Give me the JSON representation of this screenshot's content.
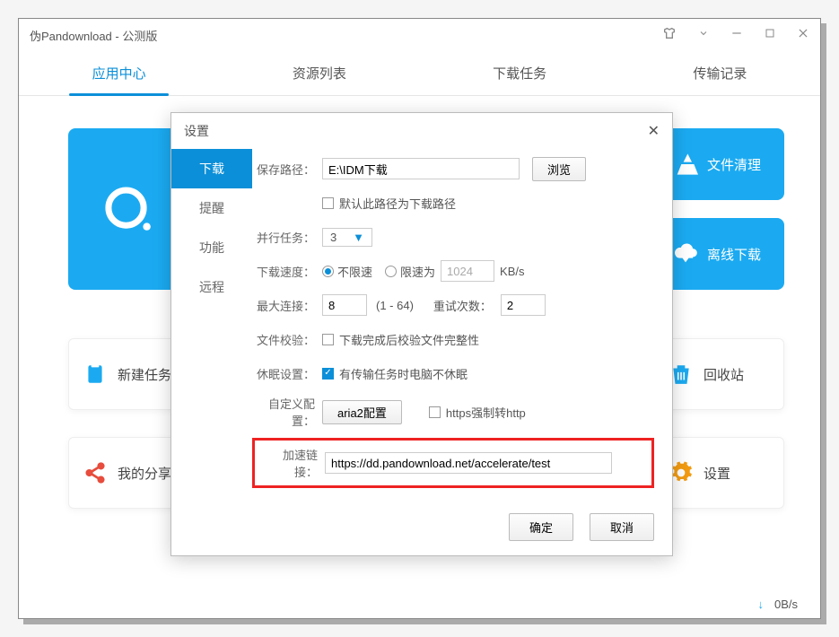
{
  "window": {
    "title": "伪Pandownload - 公测版"
  },
  "tabs": [
    "应用中心",
    "资源列表",
    "下载任务",
    "传输记录"
  ],
  "active_tab": 0,
  "right_tiles": [
    {
      "label": "文件清理"
    },
    {
      "label": "离线下载"
    }
  ],
  "bottom_items": {
    "new_task": "新建任务",
    "my_share": "我的分享",
    "recycle": "回收站",
    "settings": "设置"
  },
  "statusbar": {
    "speed": "0B/s"
  },
  "dialog": {
    "title": "设置",
    "sidebar": [
      "下载",
      "提醒",
      "功能",
      "远程"
    ],
    "active_sidebar": 0,
    "labels": {
      "save_path": "保存路径：",
      "default_path": "默认此路径为下载路径",
      "parallel": "并行任务：",
      "speed": "下载速度：",
      "speed_unlimited": "不限速",
      "speed_limited": "限速为",
      "speed_unit": "KB/s",
      "max_conn": "最大连接：",
      "max_conn_range": "(1 - 64)",
      "retry": "重试次数：",
      "verify": "文件校验：",
      "verify_cb": "下载完成后校验文件完整性",
      "sleep": "休眠设置：",
      "sleep_cb": "有传输任务时电脑不休眠",
      "custom": "自定义配置：",
      "aria2": "aria2配置",
      "https_force": "https强制转http",
      "accel": "加速链接："
    },
    "values": {
      "save_path": "E:\\IDM下载",
      "browse": "浏览",
      "parallel": "3",
      "speed_limit": "1024",
      "max_conn": "8",
      "retry": "2",
      "accel_url": "https://dd.pandownload.net/accelerate/test"
    },
    "buttons": {
      "ok": "确定",
      "cancel": "取消"
    }
  }
}
